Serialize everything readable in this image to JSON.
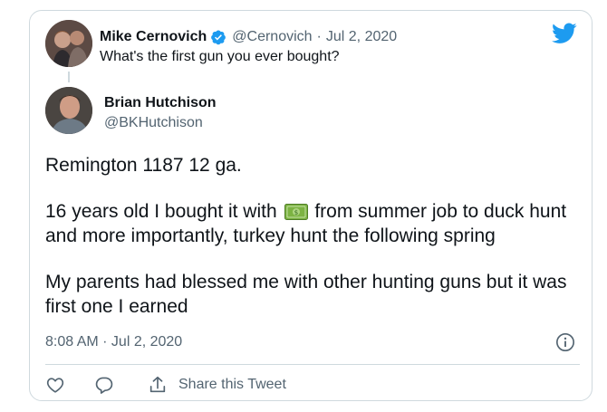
{
  "parent_tweet": {
    "author_name": "Mike Cernovich",
    "handle": "@Cernovich",
    "separator": "·",
    "date": "Jul 2, 2020",
    "text": "What's the first gun you ever bought?"
  },
  "tweet": {
    "author_name": "Brian Hutchison",
    "handle": "@BKHutchison",
    "line1": "Remington 1187 12 ga.",
    "line2_before_emoji": "16 years old I bought it with",
    "line2_after_emoji": "from summer job to duck hunt and more importantly, turkey hunt the following spring",
    "line3": "My parents had blessed me with other hunting guns but it was first one I earned",
    "timestamp": "8:08 AM · Jul 2, 2020"
  },
  "actions": {
    "share_label": "Share this Tweet"
  },
  "colors": {
    "twitter_blue": "#1d9bf0",
    "muted_text": "#536471",
    "border": "#cfd9de",
    "money_green": "#7cb342"
  },
  "icons": [
    "twitter-bird-icon",
    "verified-badge-icon",
    "money-emoji-icon",
    "info-icon",
    "like-heart-icon",
    "reply-bubble-icon",
    "share-icon"
  ]
}
